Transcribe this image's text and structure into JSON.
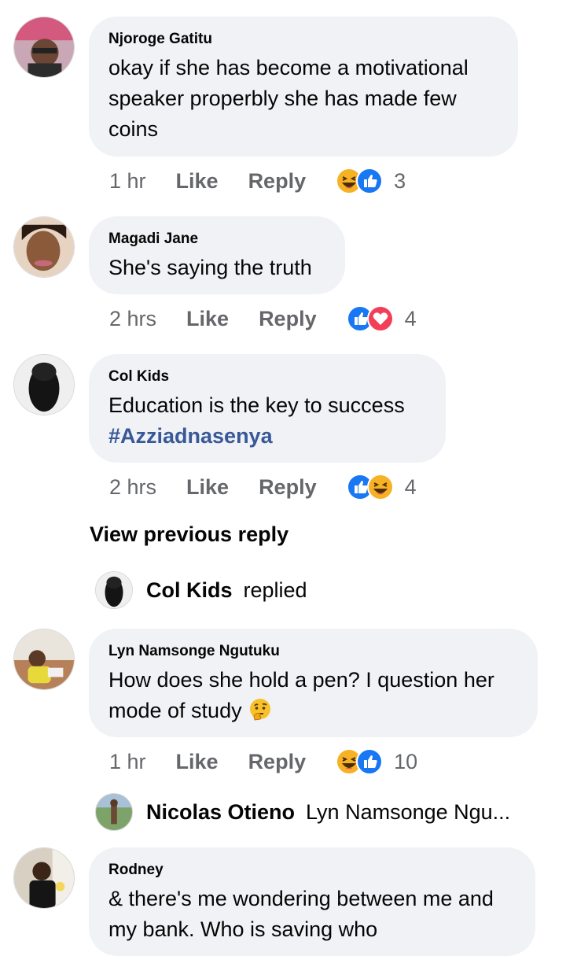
{
  "comments": [
    {
      "author": "Njoroge Gatitu",
      "text": "okay if she has become a motivational speaker properbly she has made few coins",
      "time": "1 hr",
      "like_label": "Like",
      "reply_label": "Reply",
      "reactions": [
        "haha-icon",
        "like-icon"
      ],
      "reaction_count": "3"
    },
    {
      "author": "Magadi Jane",
      "text": "She's saying the truth",
      "time": "2 hrs",
      "like_label": "Like",
      "reply_label": "Reply",
      "reactions": [
        "like-icon",
        "love-icon"
      ],
      "reaction_count": "4"
    },
    {
      "author": "Col Kids",
      "text": "Education is the key to success",
      "hashtag": "#Azziadnasenya",
      "time": "2 hrs",
      "like_label": "Like",
      "reply_label": "Reply",
      "reactions": [
        "like-icon",
        "haha-icon"
      ],
      "reaction_count": "4"
    },
    {
      "author": "Lyn Namsonge Ngutuku",
      "text": "How does she hold a pen? I question her mode of study",
      "emoji": "thinking-face-icon",
      "time": "1 hr",
      "like_label": "Like",
      "reply_label": "Reply",
      "reactions": [
        "haha-icon",
        "like-icon"
      ],
      "reaction_count": "10"
    },
    {
      "author": "Rodney",
      "text": "& there's me wondering between me and my bank. Who is saving who"
    }
  ],
  "view_previous_reply": "View previous reply",
  "reply_previews": [
    {
      "name": "Col Kids",
      "text": "replied"
    },
    {
      "name": "Nicolas Otieno",
      "text": "Lyn Namsonge Ngu..."
    }
  ],
  "colors": {
    "bubble": "#f0f2f5",
    "like_blue": "#1877f2",
    "love_red": "#f33e58",
    "haha_yellow": "#f7b125",
    "meta_gray": "#65676b",
    "hashtag": "#385898"
  }
}
